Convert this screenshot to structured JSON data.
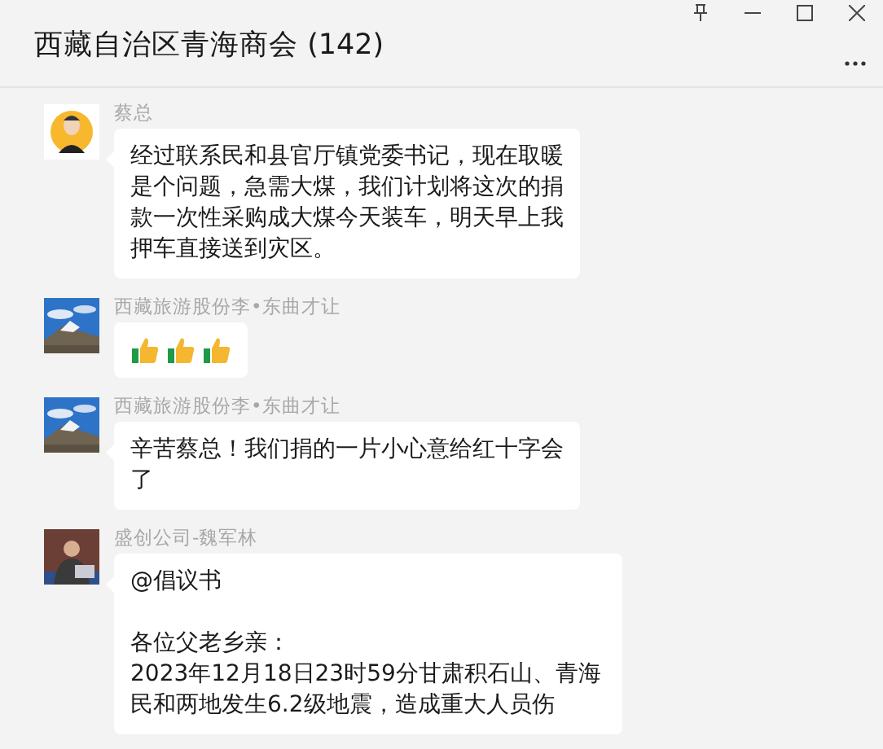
{
  "window": {
    "title": "西藏自治区青海商会 (142)"
  },
  "messages": [
    {
      "sender": "蔡总",
      "avatar": {
        "kind": "figure"
      },
      "kind": "text",
      "text": "经过联系民和县官厅镇党委书记，现在取暖是个问题，急需大煤，我们计划将这次的捐款一次性采购成大煤今天装车，明天早上我押车直接送到灾区。"
    },
    {
      "sender": "西藏旅游股份李•东曲才让",
      "avatar": {
        "kind": "mountain"
      },
      "kind": "emoji",
      "emojis": [
        {
          "kind": "thumbs_up"
        },
        {
          "kind": "thumbs_up"
        },
        {
          "kind": "thumbs_up"
        }
      ]
    },
    {
      "sender": "西藏旅游股份李•东曲才让",
      "avatar": {
        "kind": "mountain"
      },
      "kind": "text",
      "text": "辛苦蔡总！我们捐的一片小心意给红十字会了"
    },
    {
      "sender": "盛创公司-魏军林",
      "avatar": {
        "kind": "office"
      },
      "kind": "letter",
      "paragraphs": [
        "@倡议书",
        "各位父老乡亲：",
        "2023年12月18日23时59分甘肃积石山、青海民和两地发生6.2级地震，造成重大人员伤"
      ]
    }
  ]
}
